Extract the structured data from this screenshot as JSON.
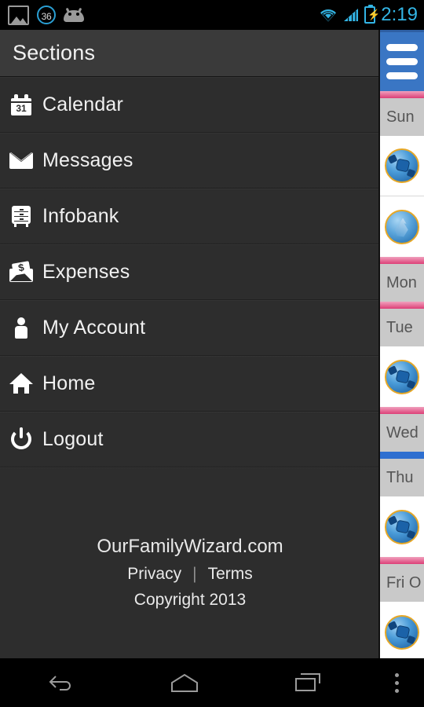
{
  "statusbar": {
    "image_icon": "image-icon",
    "badge_count": "36",
    "droid_icon": "android-mascot-icon",
    "wifi_icon": "wifi-icon",
    "signal_icon": "cell-signal-icon",
    "battery_icon": "battery-charging-icon",
    "time": "2:19"
  },
  "drawer": {
    "title": "Sections",
    "items": [
      {
        "label": "Calendar",
        "icon": "calendar-icon",
        "day": "31"
      },
      {
        "label": "Messages",
        "icon": "envelope-icon"
      },
      {
        "label": "Infobank",
        "icon": "filing-cabinet-icon"
      },
      {
        "label": "Expenses",
        "icon": "money-envelope-icon",
        "symbol": "$"
      },
      {
        "label": "My Account",
        "icon": "person-icon"
      },
      {
        "label": "Home",
        "icon": "house-icon"
      },
      {
        "label": "Logout",
        "icon": "power-icon"
      }
    ],
    "footer": {
      "site": "OurFamilyWizard.com",
      "privacy": "Privacy",
      "divider": "|",
      "terms": "Terms",
      "copyright": "Copyright 2013"
    }
  },
  "calendar_strip": {
    "menu_button": "hamburger-menu-icon",
    "rows": [
      {
        "type": "separator",
        "color": "#dd3f77"
      },
      {
        "type": "day",
        "label": "Sun"
      },
      {
        "type": "event",
        "icon": "soccer-ball-icon"
      },
      {
        "type": "event",
        "icon": "flame-icon"
      },
      {
        "type": "separator",
        "color": "#dd3f77"
      },
      {
        "type": "day",
        "label": "Mon"
      },
      {
        "type": "separator",
        "color": "#dd3f77"
      },
      {
        "type": "day",
        "label": "Tue"
      },
      {
        "type": "event",
        "icon": "soccer-ball-icon"
      },
      {
        "type": "separator",
        "color": "#dd3f77"
      },
      {
        "type": "day",
        "label": "Wed"
      },
      {
        "type": "separator",
        "color": "#2e6fd0"
      },
      {
        "type": "day",
        "label": "Thu"
      },
      {
        "type": "event",
        "icon": "soccer-ball-icon"
      },
      {
        "type": "separator",
        "color": "#dd3f77"
      },
      {
        "type": "day",
        "label": "Fri O"
      },
      {
        "type": "event",
        "icon": "soccer-ball-icon"
      }
    ]
  },
  "navbar": {
    "back": "back-icon",
    "home": "home-icon",
    "recents": "recent-apps-icon",
    "overflow": "overflow-menu-icon"
  },
  "colors": {
    "accent_blue": "#33b5e5",
    "menu_blue": "#3a76c4",
    "pink": "#dd3f77",
    "event_blue": "#2e6fd0",
    "drawer_bg": "#2b2b2b",
    "header_bg": "#3a3a3a"
  }
}
